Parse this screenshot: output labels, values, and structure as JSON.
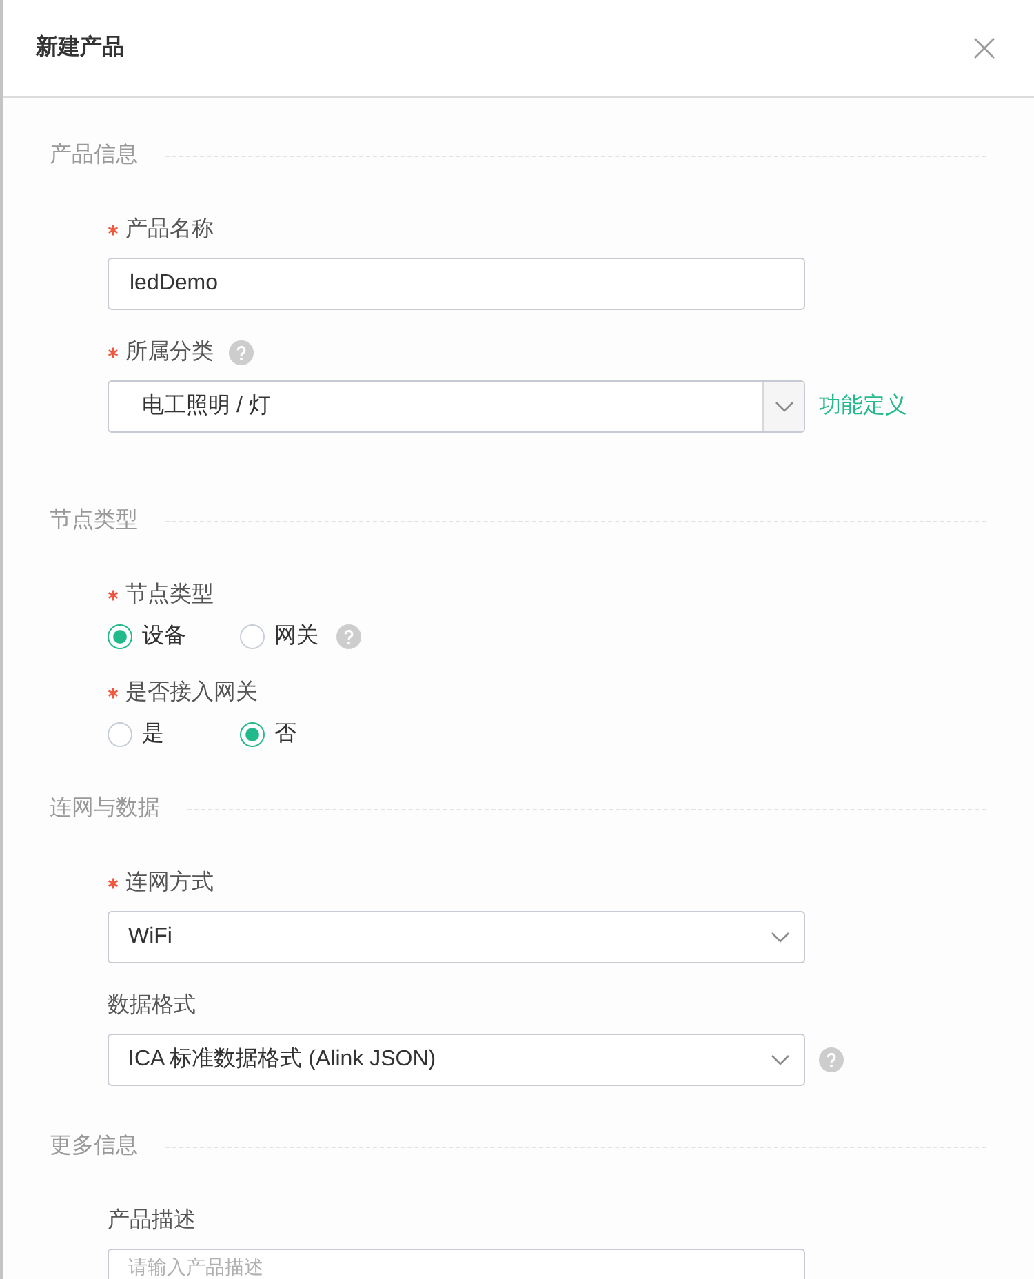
{
  "dialog": {
    "title": "新建产品"
  },
  "sections": [
    {
      "title": "产品信息",
      "fields": [
        {
          "kind": "text",
          "label": "产品名称",
          "required": true,
          "value": "ledDemo"
        },
        {
          "kind": "cascader",
          "label": "所属分类",
          "required": true,
          "label_help": true,
          "value": "电工照明 / 灯",
          "link": "功能定义"
        }
      ]
    },
    {
      "title": "节点类型",
      "fields": [
        {
          "kind": "radio",
          "label": "节点类型",
          "required": true,
          "options": [
            {
              "label": "设备",
              "selected": true
            },
            {
              "label": "网关",
              "selected": false
            }
          ],
          "control_help": true
        },
        {
          "kind": "radio",
          "label": "是否接入网关",
          "required": true,
          "options": [
            {
              "label": "是",
              "selected": false
            },
            {
              "label": "否",
              "selected": true
            }
          ]
        }
      ]
    },
    {
      "title": "连网与数据",
      "fields": [
        {
          "kind": "select",
          "label": "连网方式",
          "required": true,
          "value": "WiFi"
        },
        {
          "kind": "select",
          "label": "数据格式",
          "required": false,
          "value": "ICA 标准数据格式 (Alink JSON)",
          "control_help": true
        }
      ]
    },
    {
      "title": "更多信息",
      "fields": [
        {
          "kind": "textarea",
          "label": "产品描述",
          "required": false,
          "placeholder": "请输入产品描述"
        }
      ]
    }
  ]
}
